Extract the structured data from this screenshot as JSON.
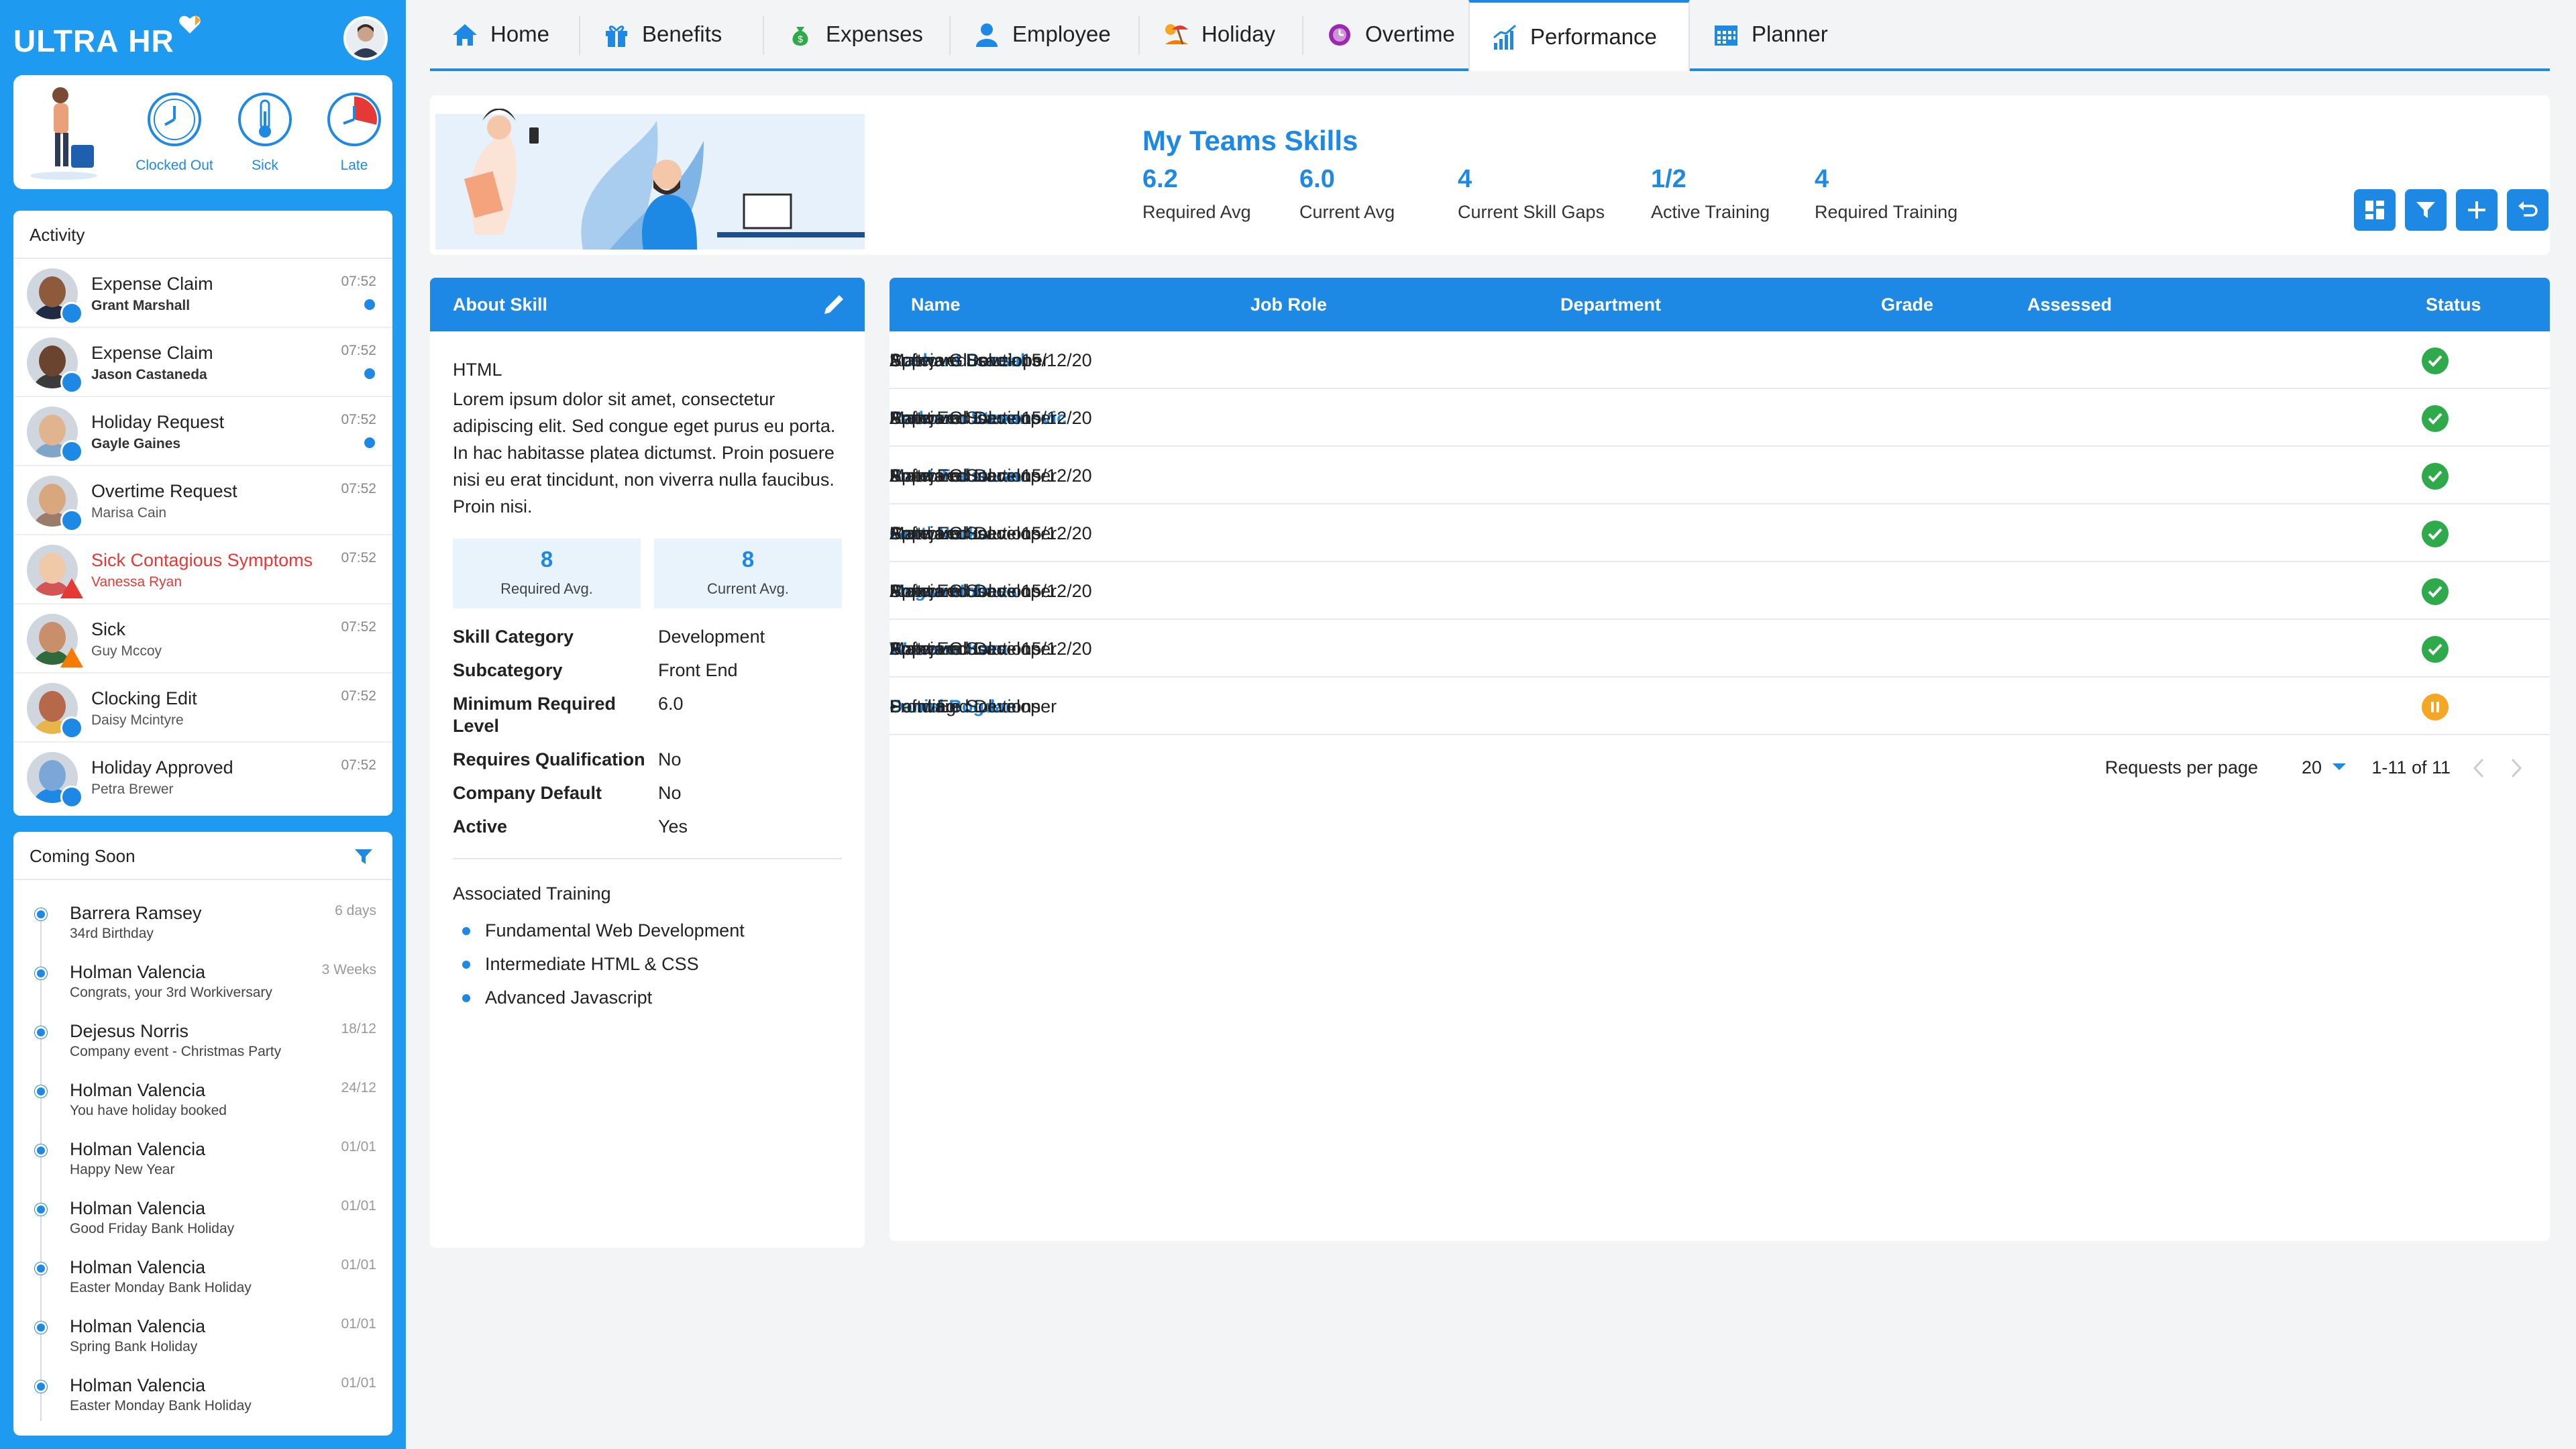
{
  "brand": {
    "logo_ultra": "ULTRA",
    "logo_hr": "HR",
    "accent": "#1e88e5",
    "sidebar_bg": "#1e9af0"
  },
  "status_card": {
    "items": [
      {
        "label": "Clocked Out",
        "icon": "clock-icon"
      },
      {
        "label": "Sick",
        "icon": "thermometer-icon"
      },
      {
        "label": "Late",
        "icon": "late-clock-icon"
      }
    ]
  },
  "activity": {
    "title": "Activity",
    "items": [
      {
        "title": "Expense Claim",
        "person": "Grant Marshall",
        "time": "07:52",
        "unread": true,
        "badge": "expense-icon"
      },
      {
        "title": "Expense Claim",
        "person": "Jason Castaneda",
        "time": "07:52",
        "unread": true,
        "badge": "expense-icon"
      },
      {
        "title": "Holiday Request",
        "person": "Gayle Gaines",
        "time": "07:52",
        "unread": true,
        "badge": "holiday-icon"
      },
      {
        "title": "Overtime Request",
        "person": "Marisa Cain",
        "time": "07:52",
        "unread": false,
        "badge": "overtime-icon"
      },
      {
        "title": "Sick Contagious Symptoms",
        "person": "Vanessa Ryan",
        "time": "07:52",
        "unread": false,
        "badge": "warning-icon"
      },
      {
        "title": "Sick",
        "person": "Guy Mccoy",
        "time": "07:52",
        "unread": false,
        "badge": "warning-icon"
      },
      {
        "title": "Clocking Edit",
        "person": "Daisy Mcintyre",
        "time": "07:52",
        "unread": false,
        "badge": "clock-icon"
      },
      {
        "title": "Holiday Approved",
        "person": "Petra Brewer",
        "time": "07:52",
        "unread": false,
        "badge": "holiday-icon"
      }
    ]
  },
  "coming_soon": {
    "title": "Coming Soon",
    "items": [
      {
        "name": "Barrera Ramsey",
        "desc": "34rd Birthday",
        "when": "6 days"
      },
      {
        "name": "Holman Valencia",
        "desc": "Congrats, your 3rd Workiversary",
        "when": "3 Weeks"
      },
      {
        "name": "Dejesus Norris",
        "desc": "Company event - Christmas Party",
        "when": "18/12"
      },
      {
        "name": "Holman Valencia",
        "desc": "You have holiday booked",
        "when": "24/12"
      },
      {
        "name": "Holman Valencia",
        "desc": "Happy New Year",
        "when": "01/01"
      },
      {
        "name": "Holman Valencia",
        "desc": "Good Friday Bank Holiday",
        "when": "01/01"
      },
      {
        "name": "Holman Valencia",
        "desc": "Easter Monday Bank Holiday",
        "when": "01/01"
      },
      {
        "name": "Holman Valencia",
        "desc": "Spring Bank Holiday",
        "when": "01/01"
      },
      {
        "name": "Holman Valencia",
        "desc": "Easter Monday Bank Holiday",
        "when": "01/01"
      }
    ]
  },
  "tabs": [
    {
      "label": "Home",
      "icon": "home-icon"
    },
    {
      "label": "Benefits",
      "icon": "gift-icon"
    },
    {
      "label": "Expenses",
      "icon": "money-bag-icon"
    },
    {
      "label": "Employee",
      "icon": "person-icon"
    },
    {
      "label": "Holiday",
      "icon": "beach-icon"
    },
    {
      "label": "Overtime",
      "icon": "overtime-icon"
    },
    {
      "label": "Performance",
      "icon": "chart-icon",
      "active": true
    },
    {
      "label": "Planner",
      "icon": "calendar-icon"
    }
  ],
  "header": {
    "title": "My Teams Skills",
    "stats": [
      {
        "value": "6.2",
        "label": "Required Avg"
      },
      {
        "value": "6.0",
        "label": "Current Avg"
      },
      {
        "value": "4",
        "label": "Current Skill Gaps"
      },
      {
        "value": "1/2",
        "label": "Active Training"
      },
      {
        "value": "4",
        "label": "Required Training"
      }
    ],
    "buttons": [
      "dashboard-icon",
      "filter-icon",
      "plus-icon",
      "undo-icon"
    ]
  },
  "about_skill": {
    "title": "About Skill",
    "skill": "HTML",
    "description": "Lorem ipsum dolor sit amet, consectetur adipiscing elit. Sed congue eget purus eu porta. In hac habitasse platea dictumst. Proin posuere nisi eu erat tincidunt, non viverra nulla faucibus. Proin nisi.",
    "required_avg": {
      "value": "8",
      "label": "Required Avg."
    },
    "current_avg": {
      "value": "8",
      "label": "Current Avg."
    },
    "fields": [
      {
        "key": "Skill Category",
        "value": "Development"
      },
      {
        "key": "Subcategory",
        "value": "Front End"
      },
      {
        "key": "Minimum Required Level",
        "value": "6.0"
      },
      {
        "key": "Requires Qualification",
        "value": "No"
      },
      {
        "key": "Company Default",
        "value": "No"
      },
      {
        "key": "Active",
        "value": "Yes"
      }
    ],
    "associated_training_title": "Associated Training",
    "associated_training": [
      "Fundamental Web Development",
      "Intermediate HTML & CSS",
      "Advanced Javascript"
    ]
  },
  "table": {
    "columns": [
      "Name",
      "Job Role",
      "Department",
      "Grade",
      "Assessed",
      "Status"
    ],
    "rows": [
      {
        "name": "Sushant Bansal",
        "role": "Software Developer",
        "dept": "Software Solutions",
        "grade": "2",
        "assessed": "Mateja Glusac - 15/12/20",
        "status": "Approved",
        "state": "approved"
      },
      {
        "name": "Radovan Stevanovic",
        "role": "Front End Developer",
        "dept": "Software Solutions",
        "grade": "2",
        "assessed": "Mateja Glusac - 15/12/20",
        "status": "Approved",
        "state": "approved"
      },
      {
        "name": "Ionut Traistarau",
        "role": "Front End Developer",
        "dept": "Software Solutions",
        "grade": "2",
        "assessed": "Mateja Glusac - 15/12/20",
        "status": "Approved",
        "state": "approved"
      },
      {
        "name": "Gerti Nurka",
        "role": "Front End Developer",
        "dept": "Software Solutions",
        "grade": "2",
        "assessed": "Mateja Glusac - 15/12/20",
        "status": "Approved",
        "state": "approved"
      },
      {
        "name": "Megan Holmes",
        "role": "Front End Developer",
        "dept": "Software Solutions",
        "grade": "2",
        "assessed": "Mateja Glusac - 15/12/20",
        "status": "Approved",
        "state": "approved"
      },
      {
        "name": "Waseem Kara",
        "role": "Front End Developer",
        "dept": "Software Solutions",
        "grade": "2",
        "assessed": "Mateja Glusac - 15/12/20",
        "status": "Approved",
        "state": "approved"
      },
      {
        "name": "Daniel Bogdan",
        "role": "Front End Developer",
        "dept": "Software Solutions",
        "grade": "-",
        "assessed": "-",
        "status": "Pending",
        "state": "pending"
      }
    ],
    "pager": {
      "label": "Requests per page",
      "per_page": "20",
      "range": "1-11 of 11"
    }
  }
}
